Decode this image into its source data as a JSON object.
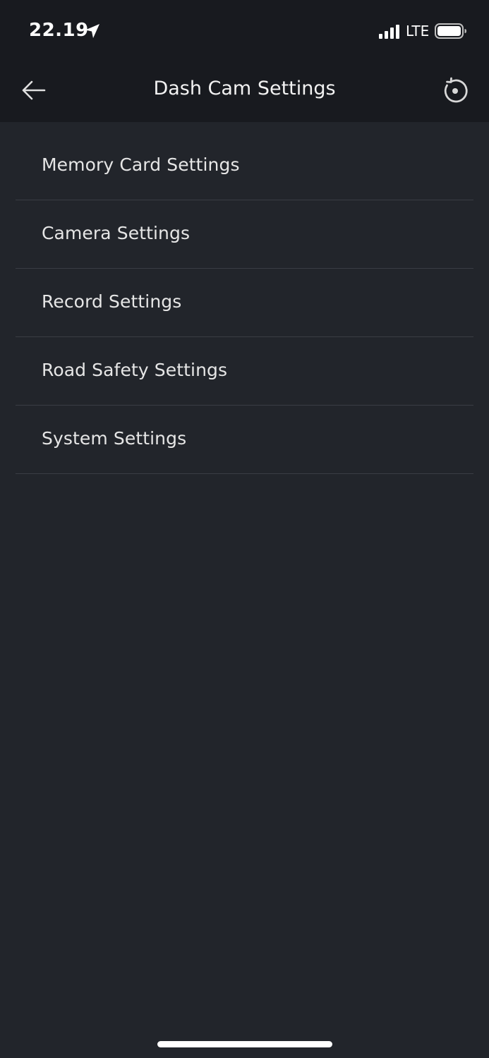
{
  "status_bar": {
    "time": "22.19",
    "network": "LTE",
    "icons": {
      "location": "location-arrow-icon",
      "signal": "cellular-signal-icon",
      "battery": "battery-icon"
    }
  },
  "header": {
    "title": "Dash Cam Settings",
    "back_icon": "arrow-left-icon",
    "reset_icon": "reset-circle-icon"
  },
  "menu": {
    "items": [
      {
        "label": "Memory Card Settings"
      },
      {
        "label": "Camera Settings"
      },
      {
        "label": "Record Settings"
      },
      {
        "label": "Road Safety Settings"
      },
      {
        "label": "System Settings"
      }
    ]
  },
  "colors": {
    "background": "#22252b",
    "header_background": "#181a1f",
    "divider": "#3a3d44",
    "text": "#e6e6e6"
  }
}
